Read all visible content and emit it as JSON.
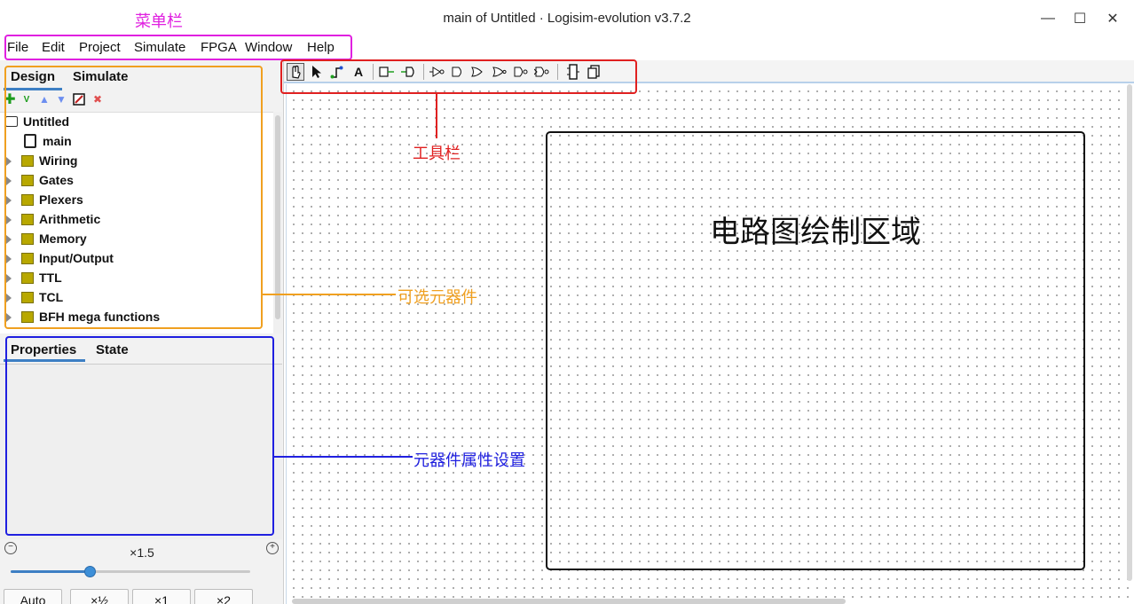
{
  "window": {
    "title": "main of Untitled · Logisim-evolution v3.7.2",
    "minimize_glyph": "—",
    "maximize_glyph": "☐",
    "close_glyph": "✕"
  },
  "menu": [
    "File",
    "Edit",
    "Project",
    "Simulate",
    "FPGA",
    "Window",
    "Help"
  ],
  "explorer_tabs": {
    "design": "Design",
    "simulate": "Simulate"
  },
  "tree": {
    "project": "Untitled",
    "circuit": "main",
    "libraries": [
      "Wiring",
      "Gates",
      "Plexers",
      "Arithmetic",
      "Memory",
      "Input/Output",
      "TTL",
      "TCL",
      "BFH mega functions"
    ]
  },
  "properties_tabs": {
    "properties": "Properties",
    "state": "State"
  },
  "zoom": {
    "value_label": "×1.5",
    "level_fraction": 0.33,
    "buttons": [
      "Auto",
      "×½",
      "×1",
      "×2"
    ]
  },
  "toolbar": {
    "tools": [
      "poke-tool",
      "select-tool",
      "wiring-tool",
      "text-tool",
      "input-pin",
      "output-pin",
      "not-gate",
      "buffer",
      "and-gate",
      "or-gate",
      "nand-gate",
      "nor-gate",
      "chip-view",
      "hierarchy-view"
    ],
    "text_tool_glyph": "A"
  },
  "canvas": {
    "drawing_area_label": "电路图绘制区域"
  },
  "annotations": {
    "menubar": "菜单栏",
    "toolbar": "工具栏",
    "components": "可选元器件",
    "properties": "元器件属性设置"
  },
  "colors": {
    "menubar_annotation": "#e020e0",
    "toolbar_annotation": "#e02020",
    "components_annotation": "#f0a020",
    "properties_annotation": "#2020e0",
    "accent": "#3d7fc4"
  }
}
